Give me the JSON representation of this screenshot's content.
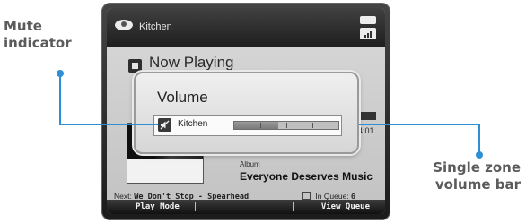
{
  "callouts": {
    "mute_indicator": [
      "Mute",
      "indicator"
    ],
    "volume_bar": [
      "Single zone",
      "volume bar"
    ]
  },
  "device": {
    "zone_name": "Kitchen",
    "now_playing_title": "Now Playing",
    "time_elapsed": "4:01",
    "album_label": "Album",
    "album_name": "Everyone Deserves Music",
    "next_label": "Next:",
    "next_track": "We Don't Stop - Spearhead",
    "in_queue_label": "In Queue:",
    "in_queue_count": "6",
    "softkeys": {
      "left": "Play Mode",
      "right": "View Queue"
    }
  },
  "volume_popup": {
    "title": "Volume",
    "zone": "Kitchen",
    "level": 0.42,
    "muted": true
  },
  "colors": {
    "accent": "#2f8fd6",
    "callout_text": "#5b5b5b"
  },
  "icons": [
    "zone-speaker-icon",
    "battery-icon",
    "signal-icon",
    "now-playing-icon",
    "mute-icon"
  ]
}
